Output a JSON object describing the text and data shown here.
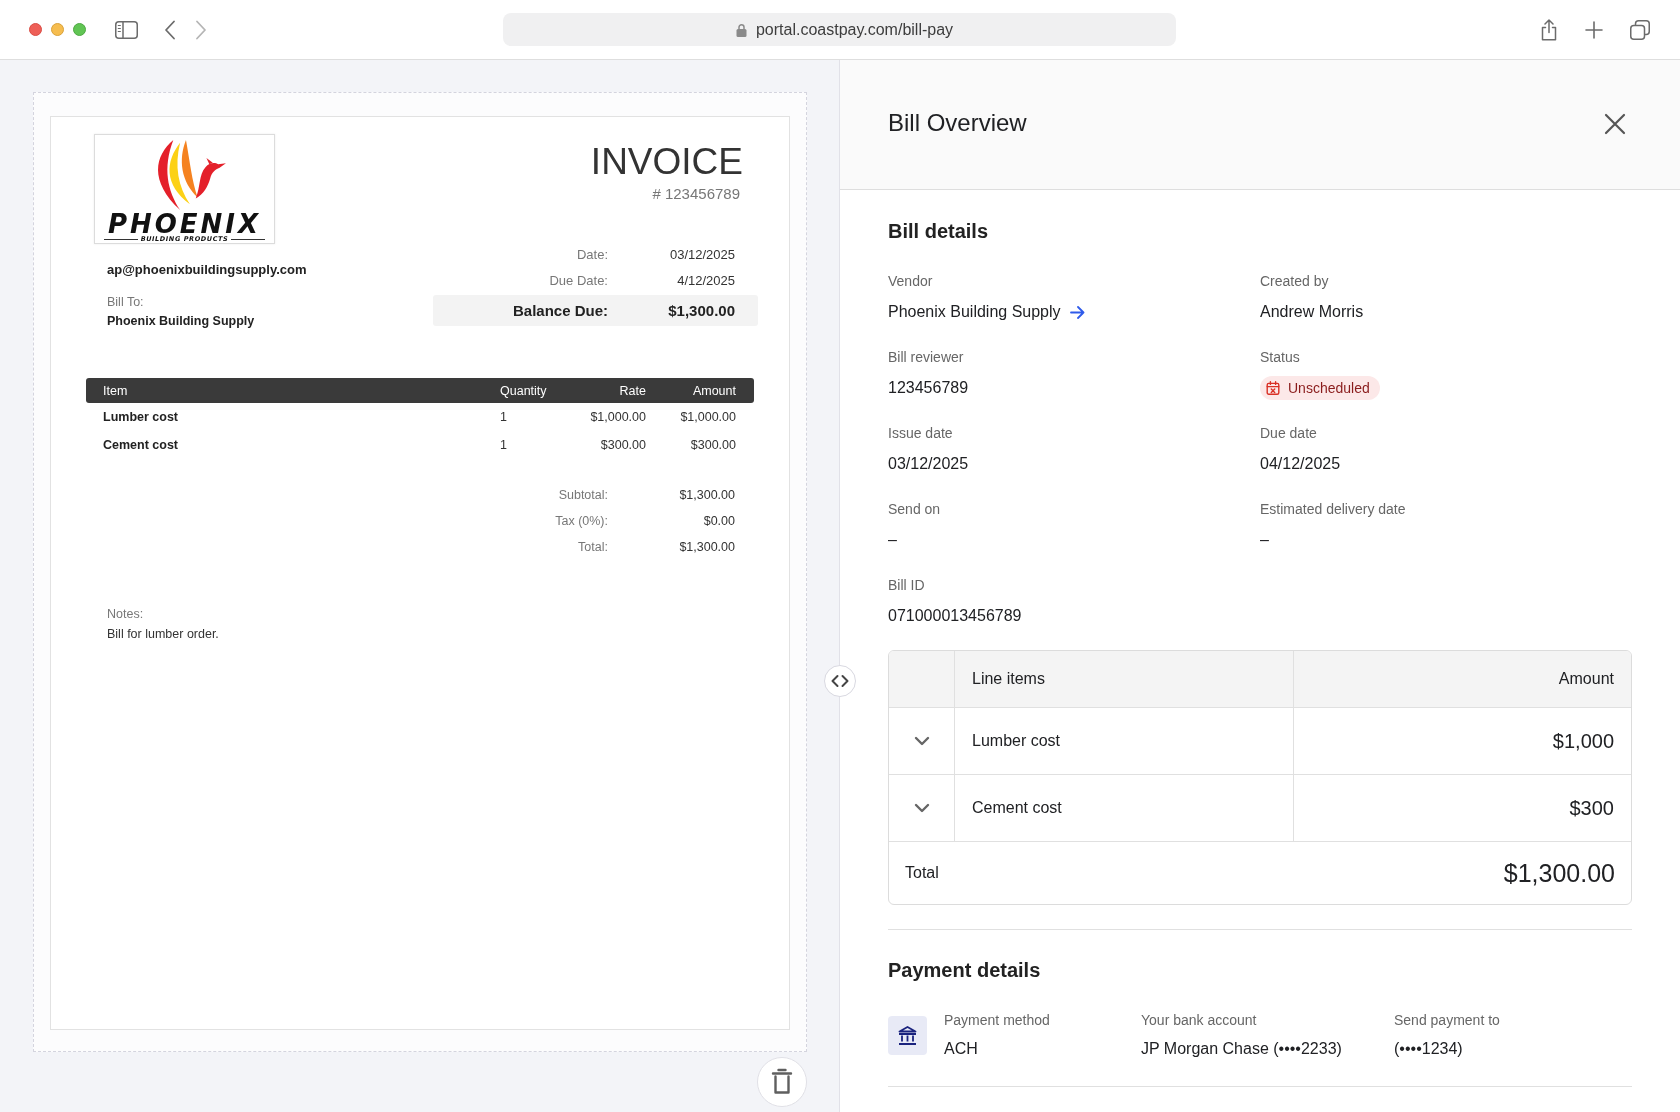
{
  "browser": {
    "url": "portal.coastpay.com/bill-pay"
  },
  "invoice": {
    "logo": {
      "wordmark": "PHOENIX",
      "tagline": "BUILDING PRODUCTS"
    },
    "title": "INVOICE",
    "number": "# 123456789",
    "email": "ap@phoenixbuildingsupply.com",
    "bill_to": {
      "label": "Bill To:",
      "name": "Phoenix Building Supply"
    },
    "meta": [
      {
        "label": "Date:",
        "value": "03/12/2025",
        "emphasized": false
      },
      {
        "label": "Due Date:",
        "value": "4/12/2025",
        "emphasized": false
      },
      {
        "label": "Balance Due:",
        "value": "$1,300.00",
        "emphasized": true
      }
    ],
    "table": {
      "columns": [
        "Item",
        "Quantity",
        "Rate",
        "Amount"
      ],
      "rows": [
        [
          "Lumber cost",
          "1",
          "$1,000.00",
          "$1,000.00"
        ],
        [
          "Cement cost",
          "1",
          "$300.00",
          "$300.00"
        ]
      ]
    },
    "totals": [
      {
        "label": "Subtotal:",
        "value": "$1,300.00"
      },
      {
        "label": "Tax (0%):",
        "value": "$0.00"
      },
      {
        "label": "Total:",
        "value": "$1,300.00"
      }
    ],
    "notes": {
      "label": "Notes:",
      "text": "Bill for lumber order."
    }
  },
  "panel": {
    "title": "Bill Overview",
    "bill_details": {
      "title": "Bill details",
      "fields": [
        {
          "label": "Vendor",
          "value": "Phoenix Building Supply",
          "kind": "link"
        },
        {
          "label": "Created by",
          "value": "Andrew Morris",
          "kind": "text"
        },
        {
          "label": "Bill reviewer",
          "value": "123456789",
          "kind": "text"
        },
        {
          "label": "Status",
          "value": "Unscheduled",
          "kind": "status"
        },
        {
          "label": "Issue date",
          "value": "03/12/2025",
          "kind": "text"
        },
        {
          "label": "Due date",
          "value": "04/12/2025",
          "kind": "text"
        },
        {
          "label": "Send on",
          "value": "–",
          "kind": "text"
        },
        {
          "label": "Estimated delivery date",
          "value": "–",
          "kind": "text"
        },
        {
          "label": "Bill ID",
          "value": "071000013456789",
          "kind": "text"
        }
      ]
    },
    "line_items": {
      "columns": [
        "Line items",
        "Amount"
      ],
      "rows": [
        {
          "name": "Lumber cost",
          "amount": "$1,000",
          "expanded": false
        },
        {
          "name": "Cement cost",
          "amount": "$300",
          "expanded": false
        }
      ],
      "total": {
        "label": "Total",
        "amount": "$1,300.00"
      }
    },
    "payment_details": {
      "title": "Payment details",
      "fields": [
        {
          "label": "Payment method",
          "value": "ACH"
        },
        {
          "label": "Your bank account",
          "value": "JP Morgan Chase (••••2233)"
        },
        {
          "label": "Send payment to",
          "value": "(••••1234)"
        }
      ]
    }
  }
}
